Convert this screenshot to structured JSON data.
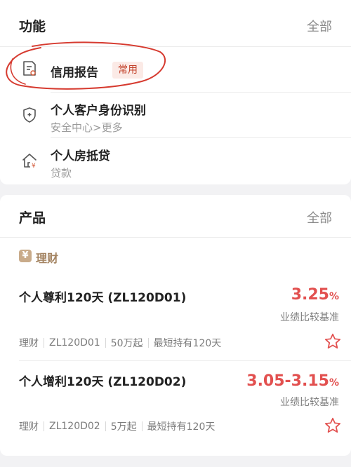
{
  "functions": {
    "title": "功能",
    "see_all": "全部",
    "items": [
      {
        "label": "信用报告",
        "badge": "常用",
        "icon": "report-icon"
      },
      {
        "label": "个人客户身份识别",
        "sub": "安全中心>更多",
        "icon": "shield-icon"
      },
      {
        "label": "个人房抵贷",
        "sub": "贷款",
        "icon": "house-icon"
      }
    ]
  },
  "products": {
    "title": "产品",
    "see_all": "全部",
    "category": {
      "icon_text": "¥",
      "label": "理财"
    },
    "items": [
      {
        "name": "个人尊利120天 (ZL120D01)",
        "rate": "3.25",
        "rate_unit": "%",
        "rate_label": "业绩比较基准",
        "tags": [
          "理财",
          "ZL120D01",
          "50万起",
          "最短持有120天"
        ]
      },
      {
        "name": "个人增利120天 (ZL120D02)",
        "rate": "3.05-3.15",
        "rate_unit": "%",
        "rate_label": "业绩比较基准",
        "tags": [
          "理财",
          "ZL120D02",
          "5万起",
          "最短持有120天"
        ]
      }
    ]
  },
  "colors": {
    "accent_red": "#e2504f",
    "badge_bg": "#fbeae6",
    "badge_text": "#c2412a",
    "category_gold": "#a48462",
    "annotation_red": "#d63a2f"
  }
}
